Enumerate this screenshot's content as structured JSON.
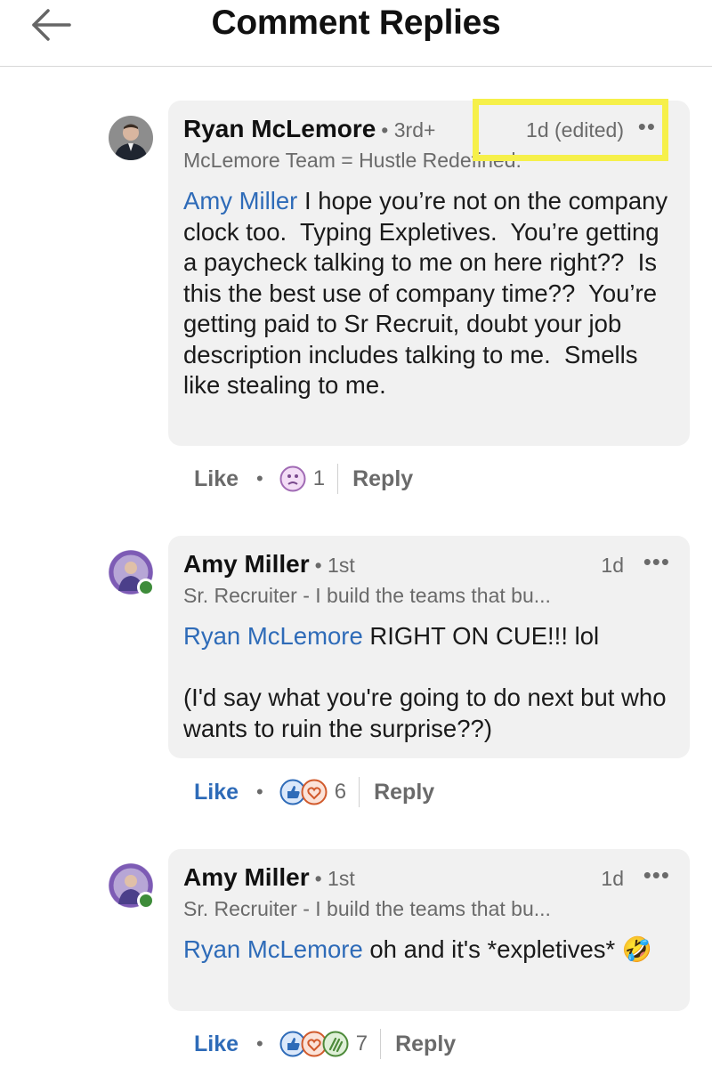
{
  "header": {
    "title": "Comment Replies",
    "back_icon": "arrow-left-icon"
  },
  "comments": [
    {
      "author": "Ryan McLemore",
      "degree": "• 3rd+",
      "time": "1d (edited)",
      "more": "••",
      "headline": "McLemore Team = Hustle Redefined.",
      "mention": "Amy Miller",
      "text": " I hope you’re not on the company clock too.  Typing Expletives.  You’re getting a paycheck talking to me on here right??  Is this the best use of company time??  You’re getting paid to Sr Recruit, doubt your job description includes talking to me.  Smells like stealing to me.",
      "like_label": "Like",
      "reaction_count": "1",
      "reply_label": "Reply"
    },
    {
      "author": "Amy Miller",
      "degree": "• 1st",
      "time": "1d",
      "more": "•••",
      "headline": "Sr. Recruiter - I build the teams that bu...",
      "mention": "Ryan McLemore",
      "text": " RIGHT ON CUE!!! lol\n\n(I'd say what you're going to do next but who wants to ruin the surprise??)",
      "like_label": "Like",
      "reaction_count": "6",
      "reply_label": "Reply"
    },
    {
      "author": "Amy Miller",
      "degree": "• 1st",
      "time": "1d",
      "more": "•••",
      "headline": "Sr. Recruiter - I build the teams that bu...",
      "mention": "Ryan McLemore",
      "text": " oh and it's *expletives* 🤣",
      "like_label": "Like",
      "reaction_count": "7",
      "reply_label": "Reply"
    }
  ],
  "colors": {
    "link_blue": "#2e6bb8",
    "bubble_bg": "#f1f1f1",
    "muted_text": "#6a6a6a",
    "highlight_yellow": "#f6f04a",
    "online_green": "#3e8c3a"
  }
}
